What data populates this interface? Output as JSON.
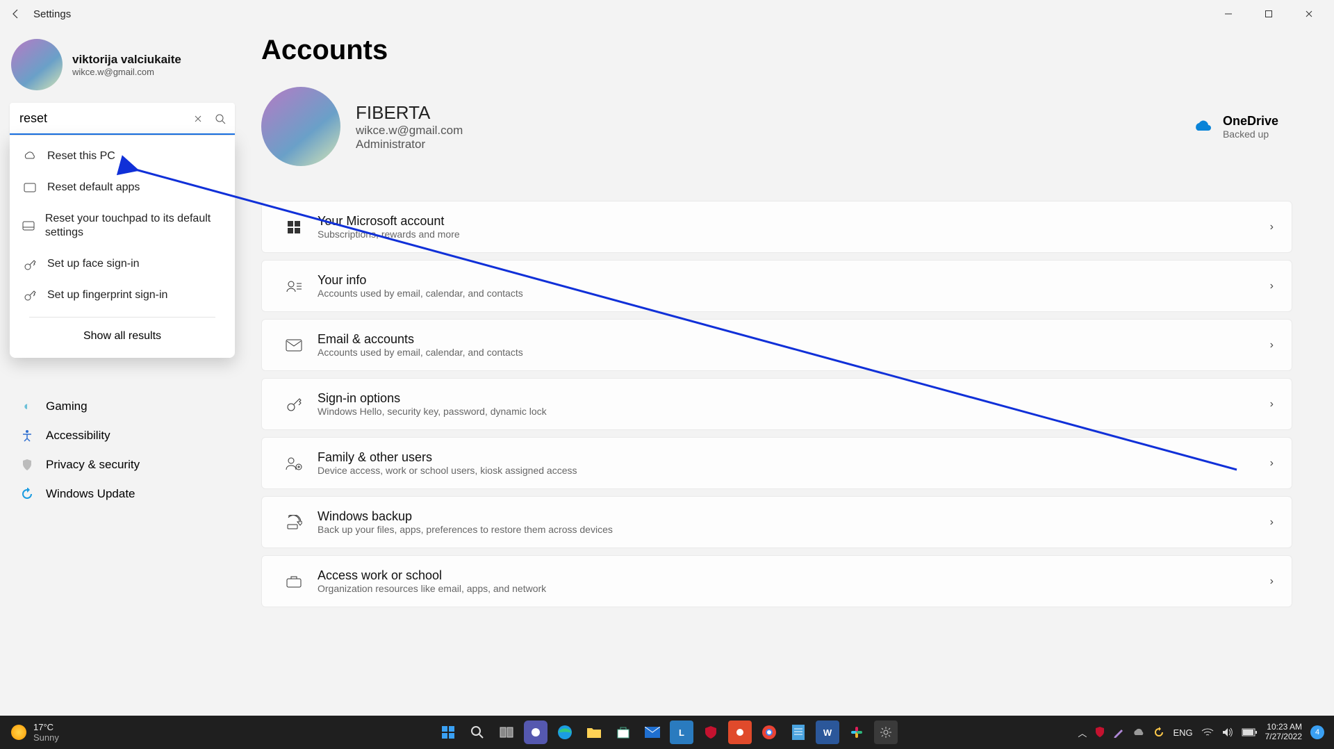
{
  "window": {
    "title": "Settings"
  },
  "user": {
    "name": "viktorija valciukaite",
    "email": "wikce.w@gmail.com"
  },
  "search": {
    "value": "reset"
  },
  "search_results": [
    {
      "icon": "cloud-reset-icon",
      "label": "Reset this PC"
    },
    {
      "icon": "apps-icon",
      "label": "Reset default apps"
    },
    {
      "icon": "touchpad-icon",
      "label": "Reset your touchpad to its default settings"
    },
    {
      "icon": "key-icon",
      "label": "Set up face sign-in"
    },
    {
      "icon": "key-icon",
      "label": "Set up fingerprint sign-in"
    }
  ],
  "search_footer": "Show all results",
  "sidebar_visible": [
    {
      "icon": "gaming-icon",
      "label": "Gaming",
      "color": "#6cc0d8"
    },
    {
      "icon": "accessibility-icon",
      "label": "Accessibility",
      "color": "#2f6fd0"
    },
    {
      "icon": "privacy-icon",
      "label": "Privacy & security",
      "color": "#8a8a8a"
    },
    {
      "icon": "update-icon",
      "label": "Windows Update",
      "color": "#1a9be0"
    }
  ],
  "page": {
    "heading": "Accounts",
    "display_name": "FIBERTA",
    "email": "wikce.w@gmail.com",
    "role": "Administrator",
    "onedrive": {
      "title": "OneDrive",
      "status": "Backed up"
    }
  },
  "cards": [
    {
      "icon": "microsoft-icon",
      "title": "Your Microsoft account",
      "sub": "Subscriptions, rewards and more"
    },
    {
      "icon": "your-info-icon",
      "title": "Your info",
      "sub": "Accounts used by email, calendar, and contacts"
    },
    {
      "icon": "mail-icon",
      "title": "Email & accounts",
      "sub": "Accounts used by email, calendar, and contacts"
    },
    {
      "icon": "key-icon",
      "title": "Sign-in options",
      "sub": "Windows Hello, security key, password, dynamic lock"
    },
    {
      "icon": "family-icon",
      "title": "Family & other users",
      "sub": "Device access, work or school users, kiosk assigned access"
    },
    {
      "icon": "backup-icon",
      "title": "Windows backup",
      "sub": "Back up your files, apps, preferences to restore them across devices"
    },
    {
      "icon": "briefcase-icon",
      "title": "Access work or school",
      "sub": "Organization resources like email, apps, and network"
    }
  ],
  "taskbar": {
    "weather_temp": "17°C",
    "weather_desc": "Sunny",
    "lang": "ENG",
    "time": "10:23 AM",
    "date": "7/27/2022"
  }
}
